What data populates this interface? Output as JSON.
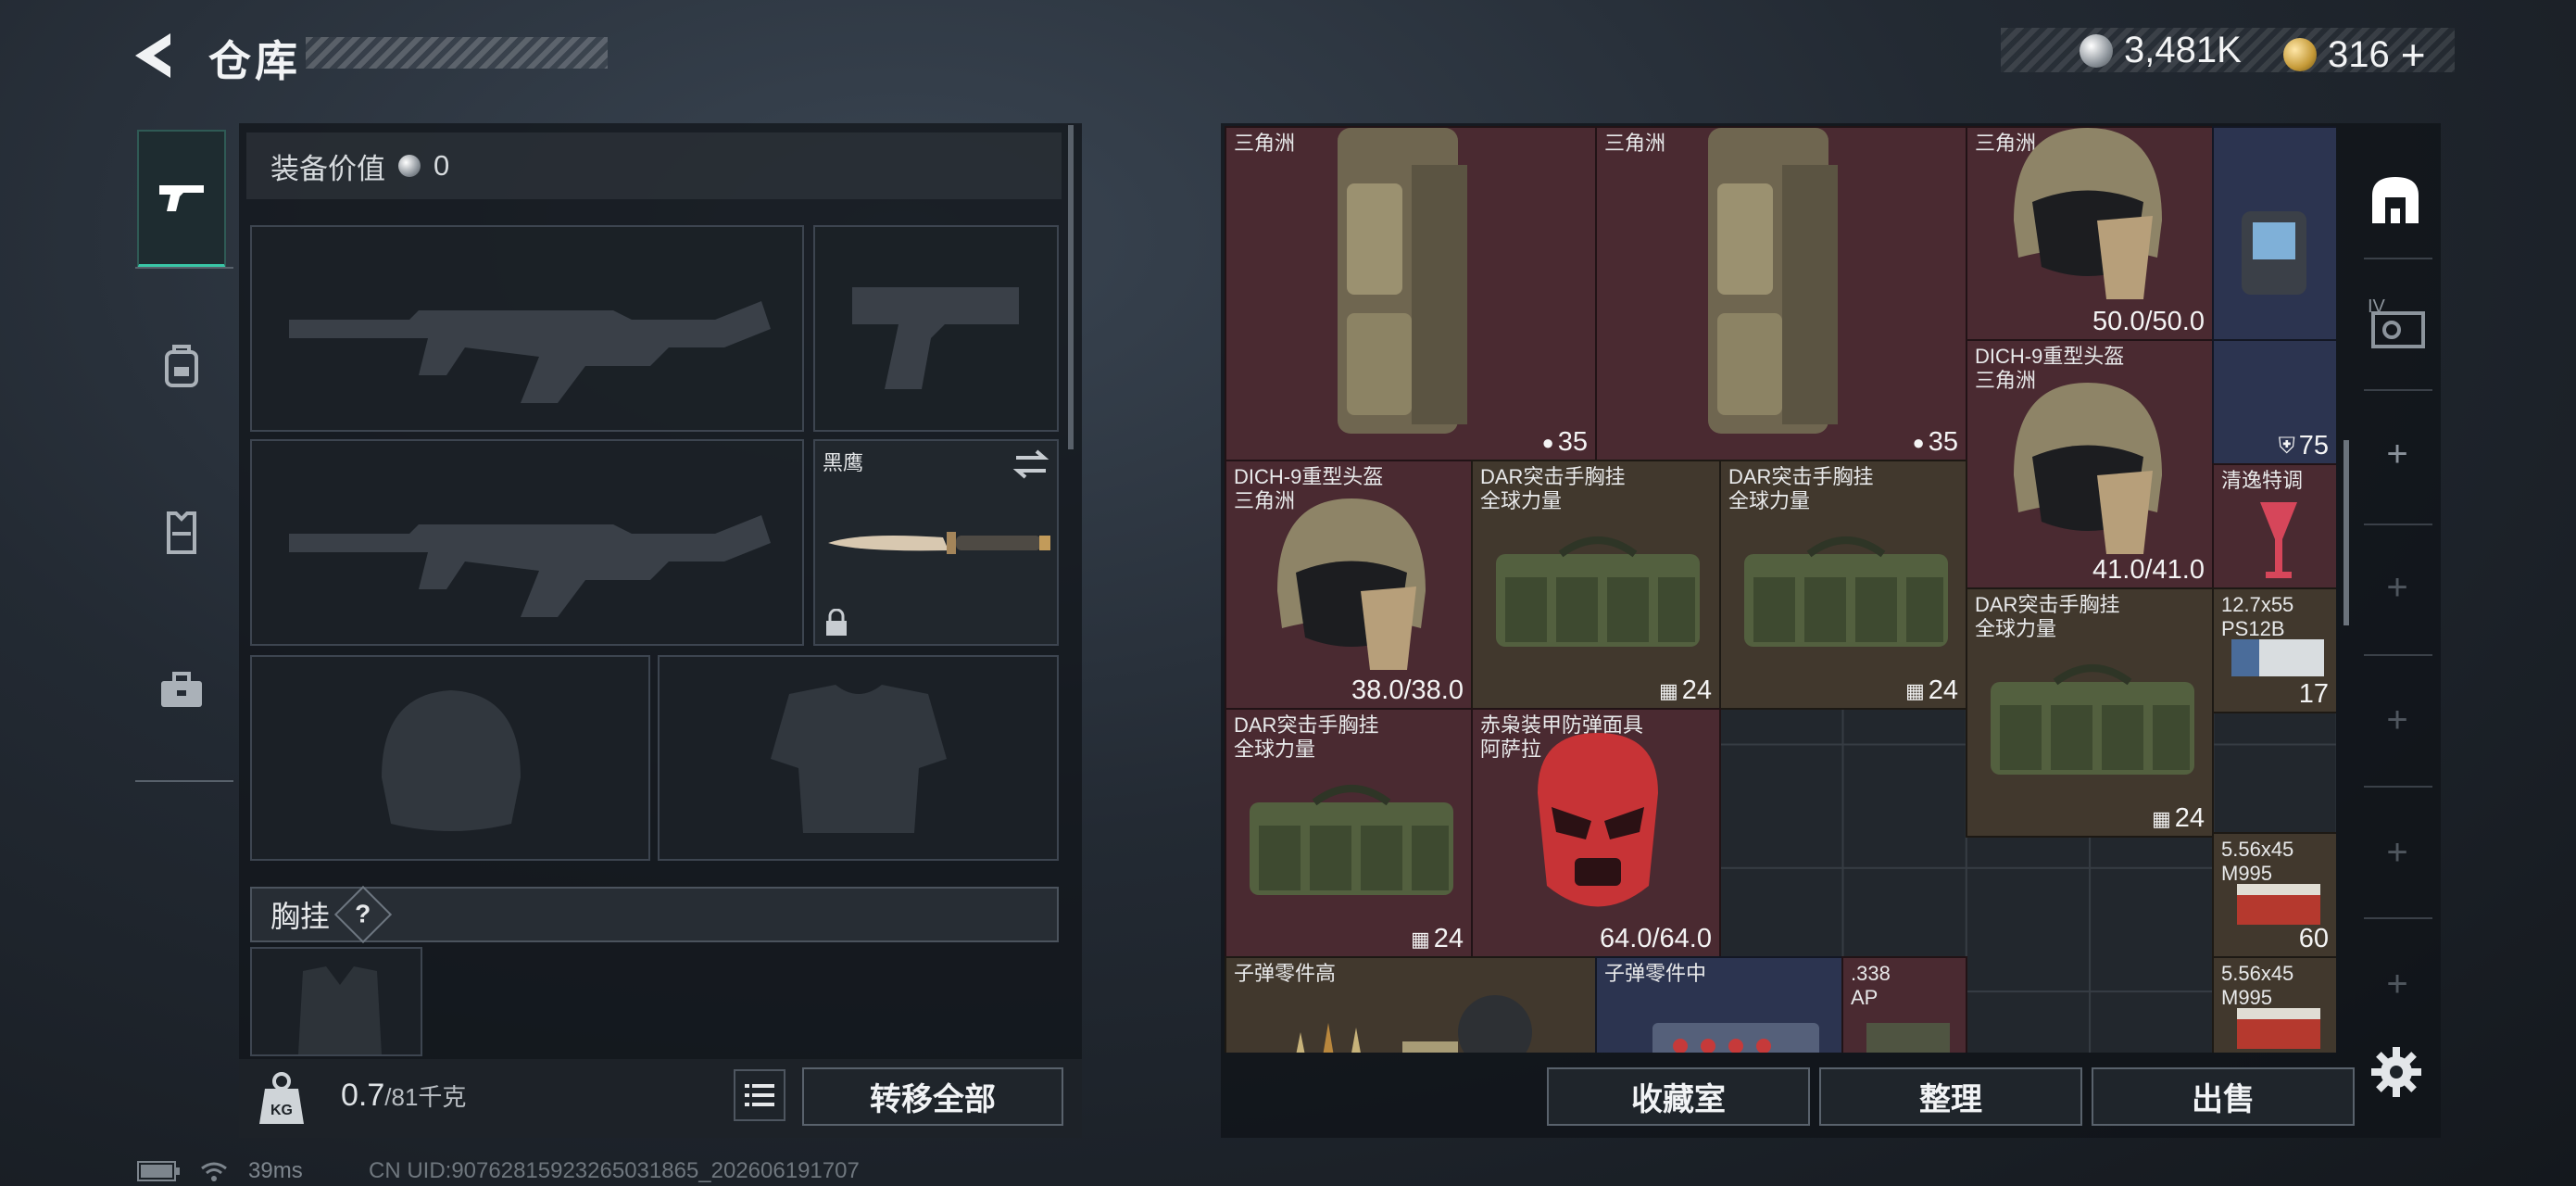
{
  "header": {
    "title": "仓库",
    "back_icon": "back-arrow-icon"
  },
  "currency": {
    "silver_amount": "3,481K",
    "gold_amount": "316",
    "gold_plus": "+"
  },
  "left_tabs": [
    "weapons-tab",
    "backpack-tab",
    "armor-tab",
    "case-tab"
  ],
  "equipment": {
    "value_label": "装备价值",
    "value_amount": "0",
    "melee_name": "黑鹰",
    "vest_label": "胸挂",
    "help_symbol": "?"
  },
  "weight": {
    "current": "0.7",
    "max": "/81千克"
  },
  "buttons": {
    "transfer_all": "转移全部",
    "vault": "收藏室",
    "sort": "整理",
    "sell": "出售"
  },
  "storage_items": [
    {
      "name": "三角洲",
      "value": "35"
    },
    {
      "name": "三角洲",
      "value": "35"
    },
    {
      "name": "三角洲",
      "value": "50.0/50.0"
    },
    {
      "name": "",
      "value": ""
    },
    {
      "name": "DICH-9重型头盔\n三角洲",
      "value": "41.0/41.0"
    },
    {
      "name": "",
      "value": "75"
    },
    {
      "name": "DICH-9重型头盔\n三角洲",
      "value": "38.0/38.0"
    },
    {
      "name": "DAR突击手胸挂\n全球力量",
      "value": "24"
    },
    {
      "name": "DAR突击手胸挂\n全球力量",
      "value": "24"
    },
    {
      "name": "清逸特调",
      "value": ""
    },
    {
      "name": "DAR突击手胸挂\n全球力量",
      "value": "24"
    },
    {
      "name": "12.7x55\nPS12B",
      "value": "17"
    },
    {
      "name": "DAR突击手胸挂\n全球力量",
      "value": "24"
    },
    {
      "name": "赤枭装甲防弹面具\n阿萨拉",
      "value": "64.0/64.0"
    },
    {
      "name": "5.56x45\nM995",
      "value": "60"
    },
    {
      "name": "子弹零件高",
      "value": ""
    },
    {
      "name": "子弹零件中",
      "value": ""
    },
    {
      "name": ".338\nAP",
      "value": ""
    },
    {
      "name": "5.56x45\nM995",
      "value": ""
    }
  ],
  "sidebar": {
    "tier_label": "IV"
  },
  "status": {
    "ping": "39ms",
    "uid": "CN UID:9076281592326503186​5_202606191707"
  },
  "colors": {
    "accent": "#39c6a6",
    "red_cell": "#4a2a31",
    "tan_cell": "#41382d",
    "blue_cell": "#2c3450"
  }
}
